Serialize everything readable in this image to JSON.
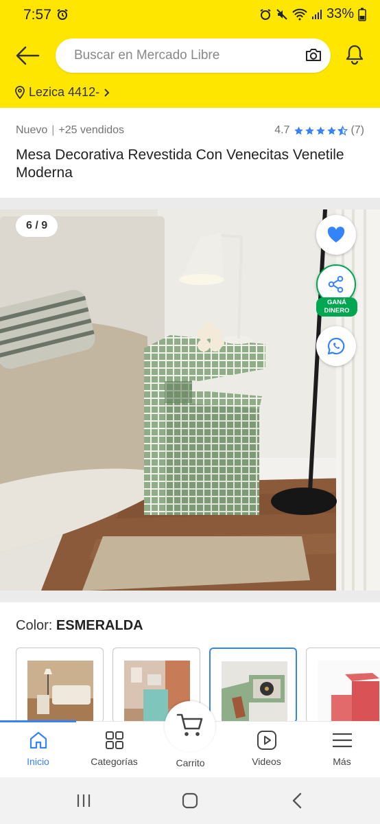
{
  "status_bar": {
    "time": "7:57",
    "battery": "33%"
  },
  "header": {
    "search_placeholder": "Buscar en Mercado Libre",
    "location": "Lezica 4412-"
  },
  "product": {
    "condition": "Nuevo",
    "sold": "+25 vendidos",
    "rating": "4.7",
    "rating_stars": 4.5,
    "reviews": "(7)",
    "title": "Mesa Decorativa Revestida Con Venecitas Venetile Moderna",
    "image_counter": "6 / 9",
    "share_badge_line1": "GANÁ",
    "share_badge_line2": "DINERO",
    "color_label": "Color:",
    "color_value": "ESMERALDA"
  },
  "colors": {
    "accent": "#3483fa",
    "brand_yellow": "#ffe600",
    "green": "#00a650"
  },
  "bottom_nav": {
    "items": [
      {
        "label": "Inicio",
        "icon": "home-icon",
        "active": true
      },
      {
        "label": "Categorías",
        "icon": "grid-icon"
      },
      {
        "label": "Carrito",
        "icon": "cart-icon"
      },
      {
        "label": "Videos",
        "icon": "play-icon"
      },
      {
        "label": "Más",
        "icon": "menu-icon"
      }
    ]
  }
}
